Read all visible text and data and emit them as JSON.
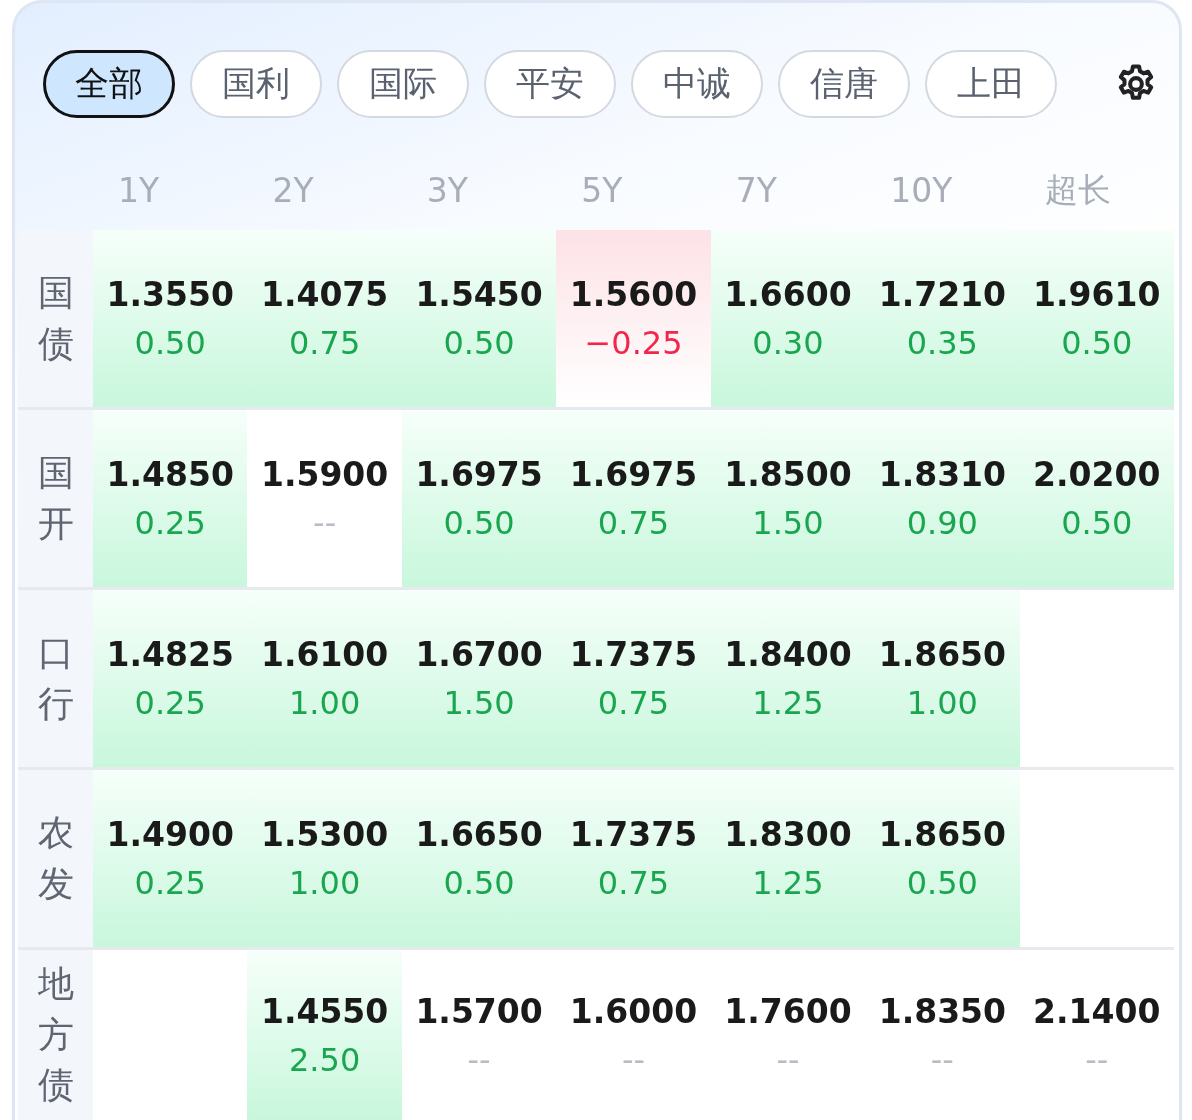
{
  "tabs": [
    {
      "label": "全部",
      "selected": true
    },
    {
      "label": "国利",
      "selected": false
    },
    {
      "label": "国际",
      "selected": false
    },
    {
      "label": "平安",
      "selected": false
    },
    {
      "label": "中诚",
      "selected": false
    },
    {
      "label": "信唐",
      "selected": false
    },
    {
      "label": "上田",
      "selected": false
    }
  ],
  "columns": [
    "1Y",
    "2Y",
    "3Y",
    "5Y",
    "7Y",
    "10Y",
    "超长"
  ],
  "rows": [
    {
      "label": "国债",
      "cells": [
        {
          "value": "1.3550",
          "change": "0.50",
          "kind": "up"
        },
        {
          "value": "1.4075",
          "change": "0.75",
          "kind": "up"
        },
        {
          "value": "1.5450",
          "change": "0.50",
          "kind": "up"
        },
        {
          "value": "1.5600",
          "change": "−0.25",
          "kind": "down"
        },
        {
          "value": "1.6600",
          "change": "0.30",
          "kind": "up"
        },
        {
          "value": "1.7210",
          "change": "0.35",
          "kind": "up"
        },
        {
          "value": "1.9610",
          "change": "0.50",
          "kind": "up"
        }
      ]
    },
    {
      "label": "国开",
      "cells": [
        {
          "value": "1.4850",
          "change": "0.25",
          "kind": "up"
        },
        {
          "value": "1.5900",
          "change": "--",
          "kind": "flat"
        },
        {
          "value": "1.6975",
          "change": "0.50",
          "kind": "up"
        },
        {
          "value": "1.6975",
          "change": "0.75",
          "kind": "up"
        },
        {
          "value": "1.8500",
          "change": "1.50",
          "kind": "up"
        },
        {
          "value": "1.8310",
          "change": "0.90",
          "kind": "up"
        },
        {
          "value": "2.0200",
          "change": "0.50",
          "kind": "up"
        }
      ]
    },
    {
      "label": "口行",
      "cells": [
        {
          "value": "1.4825",
          "change": "0.25",
          "kind": "up"
        },
        {
          "value": "1.6100",
          "change": "1.00",
          "kind": "up"
        },
        {
          "value": "1.6700",
          "change": "1.50",
          "kind": "up"
        },
        {
          "value": "1.7375",
          "change": "0.75",
          "kind": "up"
        },
        {
          "value": "1.8400",
          "change": "1.25",
          "kind": "up"
        },
        {
          "value": "1.8650",
          "change": "1.00",
          "kind": "up"
        },
        {
          "kind": "empty"
        }
      ]
    },
    {
      "label": "农发",
      "cells": [
        {
          "value": "1.4900",
          "change": "0.25",
          "kind": "up"
        },
        {
          "value": "1.5300",
          "change": "1.00",
          "kind": "up"
        },
        {
          "value": "1.6650",
          "change": "0.50",
          "kind": "up"
        },
        {
          "value": "1.7375",
          "change": "0.75",
          "kind": "up"
        },
        {
          "value": "1.8300",
          "change": "1.25",
          "kind": "up"
        },
        {
          "value": "1.8650",
          "change": "0.50",
          "kind": "up"
        },
        {
          "kind": "empty"
        }
      ]
    },
    {
      "label": "地方债",
      "cells": [
        {
          "kind": "empty"
        },
        {
          "value": "1.4550",
          "change": "2.50",
          "kind": "up"
        },
        {
          "value": "1.5700",
          "change": "--",
          "kind": "flat"
        },
        {
          "value": "1.6000",
          "change": "--",
          "kind": "flat"
        },
        {
          "value": "1.7600",
          "change": "--",
          "kind": "flat"
        },
        {
          "value": "1.8350",
          "change": "--",
          "kind": "flat"
        },
        {
          "value": "2.1400",
          "change": "--",
          "kind": "flat"
        }
      ]
    }
  ]
}
